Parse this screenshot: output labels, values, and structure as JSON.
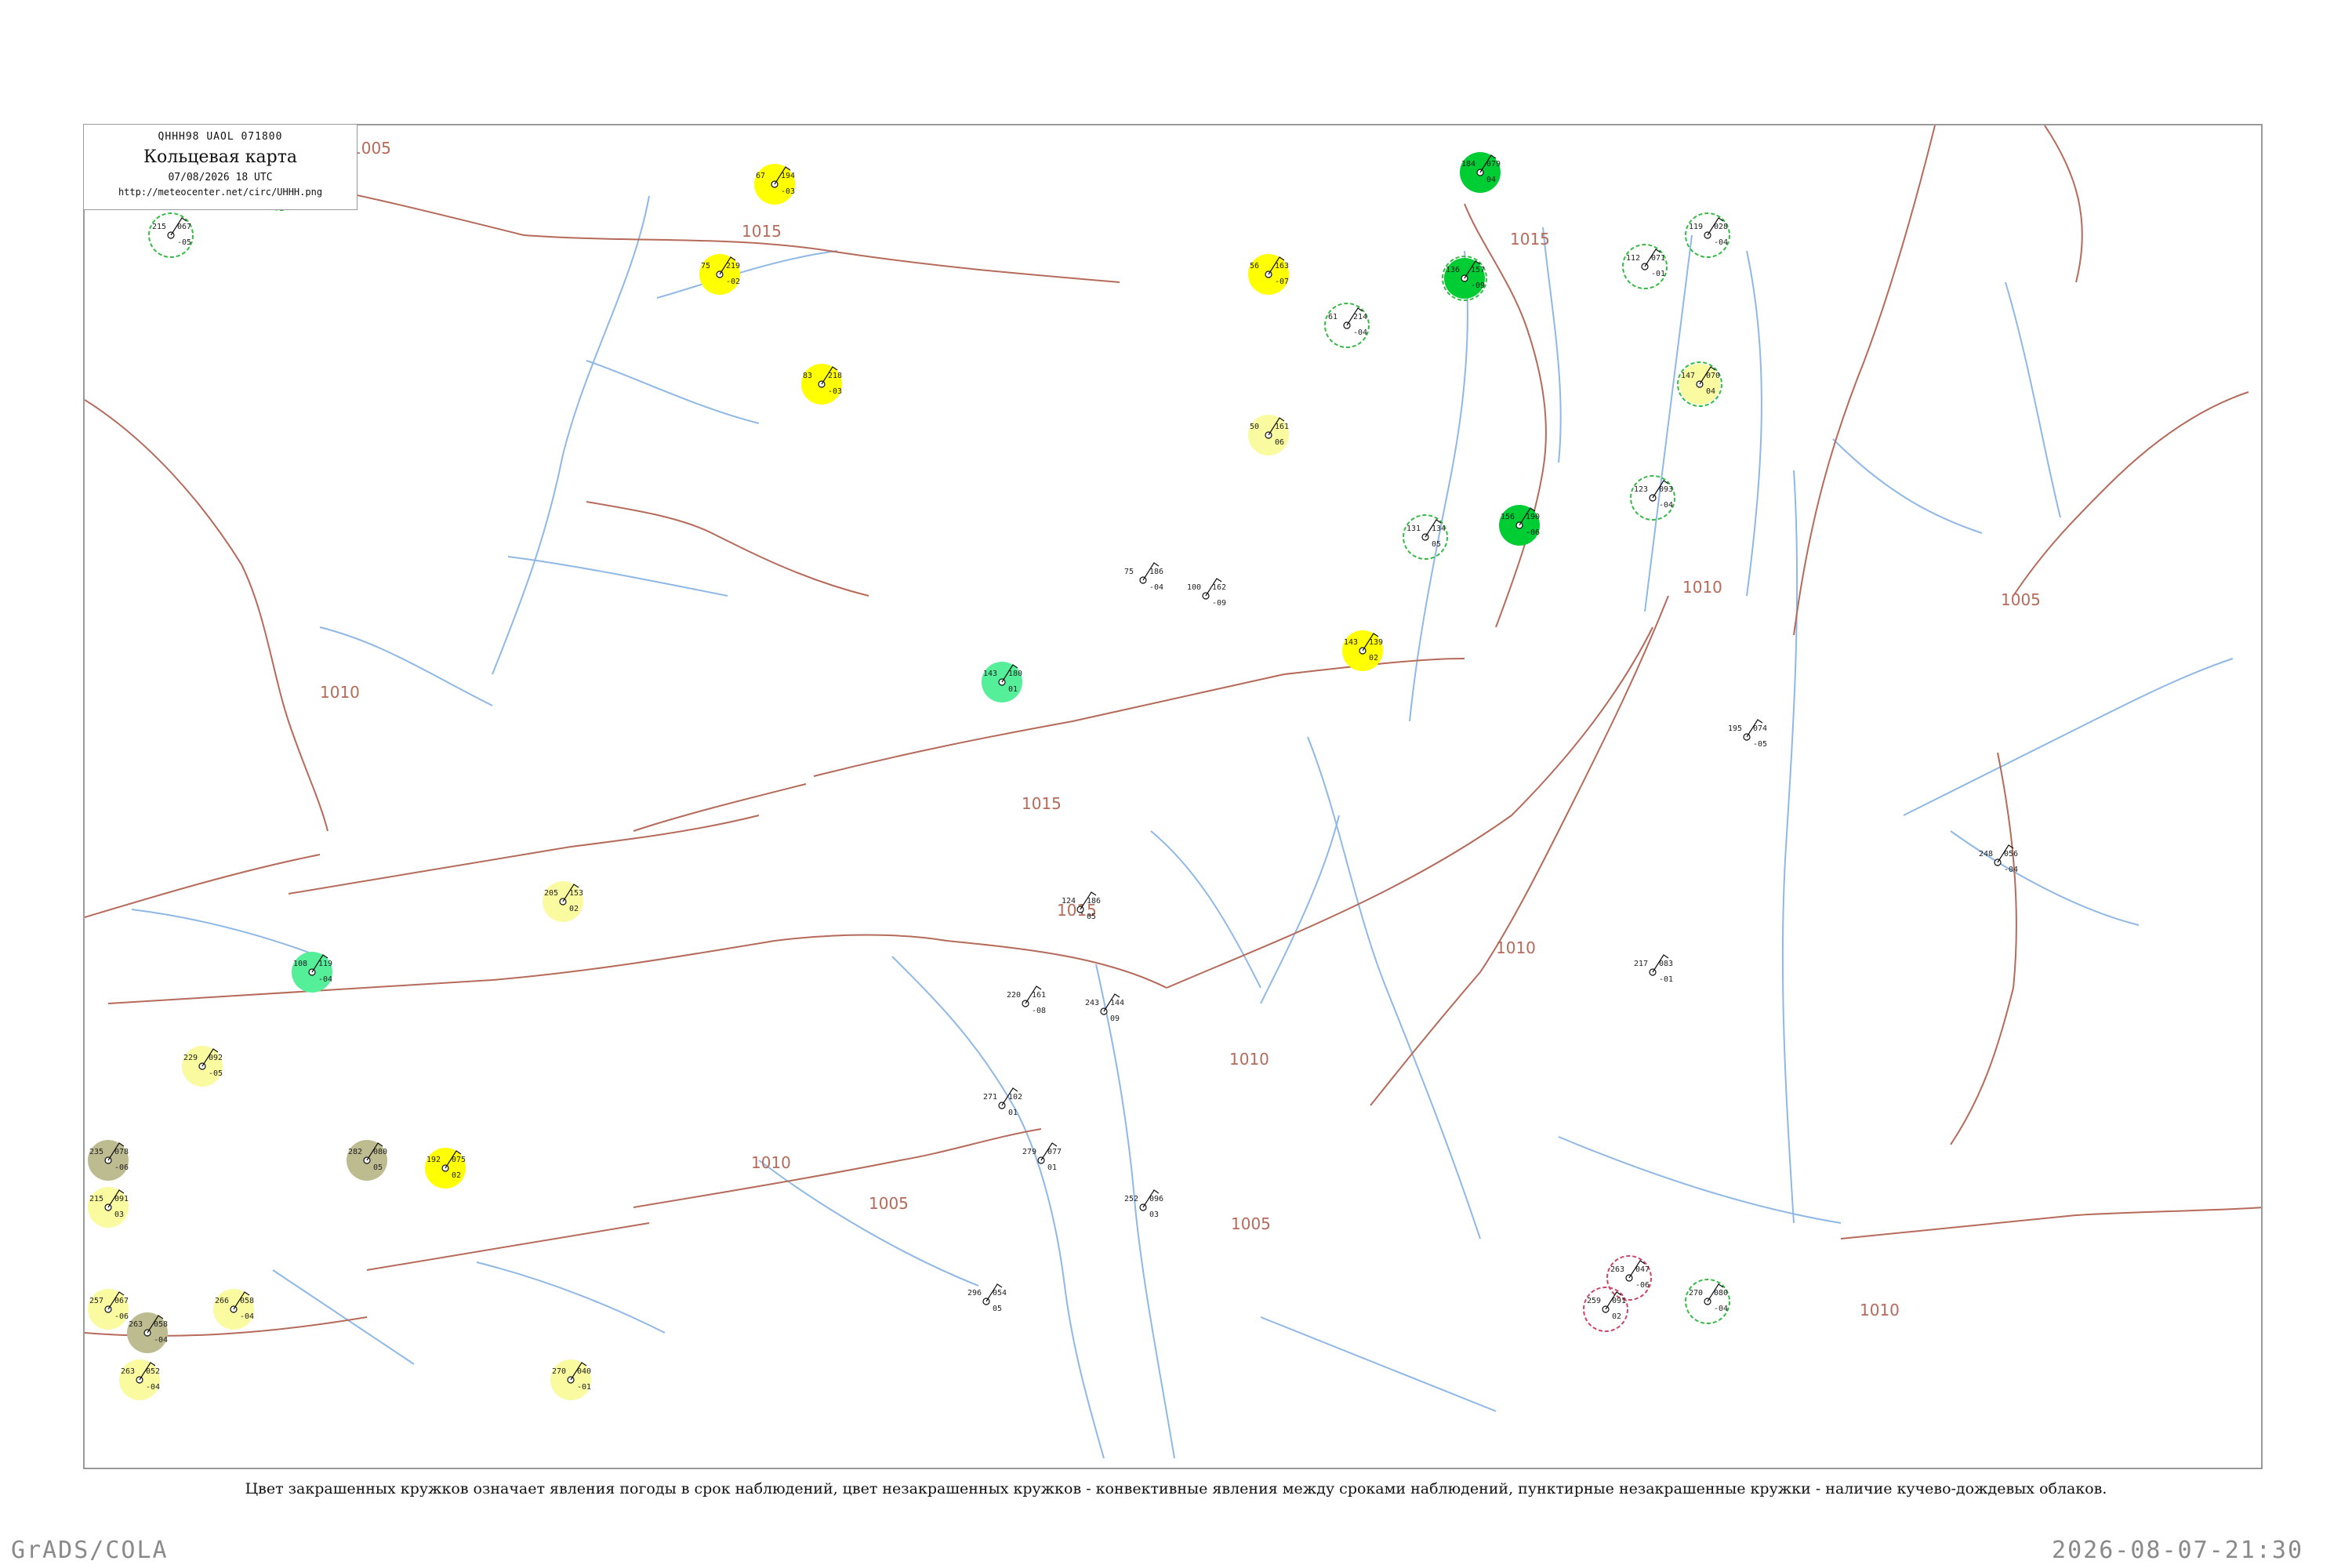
{
  "title": {
    "code": "QHHH98  UAOL  071800",
    "name": "Кольцевая карта",
    "datetime": "07/08/2026 18 UTC",
    "url": "http://meteocenter.net/circ/UHHH.png"
  },
  "caption": "Цвет закрашенных кружков означает явления погоды в срок наблюдений, цвет незакрашенных кружков - конвективные явления между сроками наблюдений, пунктирные незакрашенные кружки - наличие кучево-дождевых облаков.",
  "footer": {
    "left": "GrADS/COLA",
    "right": "2026-08-07-21:30"
  },
  "colors": {
    "frame": "#9a9a9a",
    "isobar": "#b56a5a",
    "river": "#8fb8e6",
    "fill_yellow": "#ffff00",
    "fill_pale_yellow": "#fafaa0",
    "fill_green": "#00cc33",
    "fill_light_green": "#55ee99",
    "fill_olive": "#bdbb90",
    "ring_green": "#33bb44",
    "ring_pink": "#cc4466"
  },
  "isobar_labels": [
    "1005",
    "1015",
    "1010",
    "1015",
    "1010",
    "1015",
    "1015",
    "1010",
    "1010",
    "1005",
    "1010",
    "1005",
    "1005",
    "1010"
  ],
  "stations": [
    {
      "p": "185",
      "t": "102",
      "d": "-07"
    },
    {
      "p": "146",
      "t": "141",
      "d": "11"
    },
    {
      "p": "067",
      "t": "215",
      "d": "-05"
    },
    {
      "p": "194",
      "t": "67",
      "d": "-03"
    },
    {
      "p": "163",
      "t": "56",
      "d": "-07"
    },
    {
      "p": "079",
      "t": "184",
      "d": "04"
    },
    {
      "p": "028",
      "t": "119",
      "d": "-04"
    },
    {
      "p": "071",
      "t": "112",
      "d": "-01"
    },
    {
      "p": "219",
      "t": "75",
      "d": "-02"
    },
    {
      "p": "218",
      "t": "83",
      "d": "-03"
    },
    {
      "p": "214",
      "t": "61",
      "d": "-04"
    },
    {
      "p": "157",
      "t": "136",
      "d": "-09"
    },
    {
      "p": "070",
      "t": "147",
      "d": "04"
    },
    {
      "p": "161",
      "t": "50",
      "d": "06"
    },
    {
      "p": "134",
      "t": "131",
      "d": "05"
    },
    {
      "p": "093",
      "t": "123",
      "d": "-04"
    },
    {
      "p": "190",
      "t": "156",
      "d": "-06"
    },
    {
      "p": "180",
      "t": "143",
      "d": "01"
    },
    {
      "p": "139",
      "t": "143",
      "d": "02"
    },
    {
      "p": "153",
      "t": "205",
      "d": "02"
    },
    {
      "p": "119",
      "t": "108",
      "d": "-04"
    },
    {
      "p": "092",
      "t": "229",
      "d": "-05"
    },
    {
      "p": "078",
      "t": "235",
      "d": "-06"
    },
    {
      "p": "080",
      "t": "282",
      "d": "05"
    },
    {
      "p": "075",
      "t": "192",
      "d": "02"
    },
    {
      "p": "091",
      "t": "215",
      "d": "03"
    },
    {
      "p": "067",
      "t": "257",
      "d": "-06"
    },
    {
      "p": "058",
      "t": "263",
      "d": "-04"
    },
    {
      "p": "058",
      "t": "266",
      "d": "-04"
    },
    {
      "p": "052",
      "t": "263",
      "d": "-04"
    },
    {
      "p": "040",
      "t": "270",
      "d": "-01"
    },
    {
      "p": "047",
      "t": "263",
      "d": "-06"
    },
    {
      "p": "080",
      "t": "270",
      "d": "-04"
    },
    {
      "p": "091",
      "t": "259",
      "d": "02"
    },
    {
      "p": "186",
      "t": "75",
      "d": "-04"
    },
    {
      "p": "162",
      "t": "100",
      "d": "-09"
    },
    {
      "p": "186",
      "t": "124",
      "d": "05"
    },
    {
      "p": "161",
      "t": "220",
      "d": "-08"
    },
    {
      "p": "144",
      "t": "243",
      "d": "09"
    },
    {
      "p": "102",
      "t": "271",
      "d": "01"
    },
    {
      "p": "077",
      "t": "279",
      "d": "01"
    },
    {
      "p": "096",
      "t": "252",
      "d": "03"
    },
    {
      "p": "054",
      "t": "296",
      "d": "05"
    },
    {
      "p": "074",
      "t": "195",
      "d": "-05"
    },
    {
      "p": "056",
      "t": "248",
      "d": "-04"
    },
    {
      "p": "083",
      "t": "217",
      "d": "-01"
    }
  ]
}
